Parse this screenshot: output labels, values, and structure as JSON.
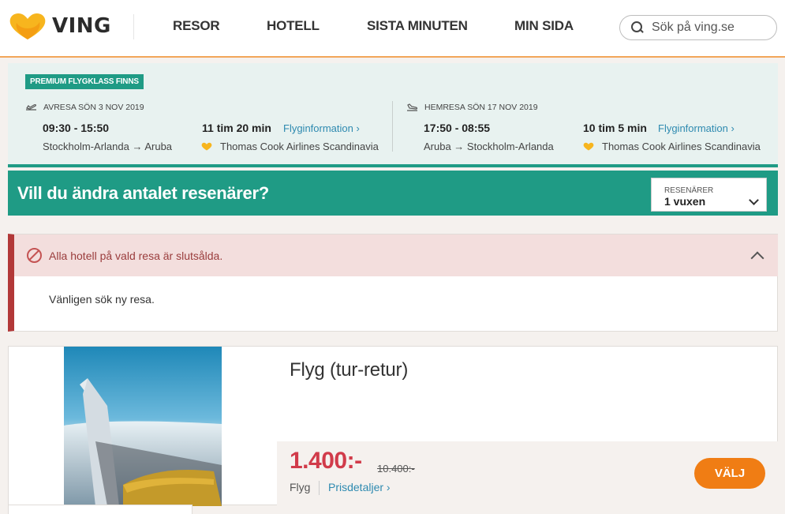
{
  "header": {
    "logo_text": "VING",
    "nav": [
      "RESOR",
      "HOTELL",
      "SISTA MINUTEN",
      "MIN SIDA"
    ],
    "search_placeholder": "Sök på ving.se"
  },
  "flight": {
    "badge": "PREMIUM FLYGKLASS FINNS",
    "outbound": {
      "heading": "AVRESA SÖN 3 NOV 2019",
      "times": "09:30 - 15:50",
      "route": "Stockholm-Arlanda → Aruba",
      "duration": "11 tim 20 min",
      "info_link": "Flyginformation",
      "airline": "Thomas Cook Airlines Scandinavia"
    },
    "inbound": {
      "heading": "HEMRESA SÖN 17 NOV 2019",
      "times": "17:50 - 08:55",
      "route": "Aruba → Stockholm-Arlanda",
      "duration": "10 tim 5 min",
      "info_link": "Flyginformation",
      "airline": "Thomas Cook Airlines Scandinavia"
    }
  },
  "travellers": {
    "title": "Vill du ändra antalet resenärer?",
    "select_label": "RESENÄRER",
    "select_value": "1 vuxen"
  },
  "alert": {
    "title": "Alla hotell på vald resa är slutsålda.",
    "body": "Vänligen sök ny resa."
  },
  "offer": {
    "title": "Flyg (tur-retur)",
    "price": "1.400:-",
    "old_price": "10.400:-",
    "type": "Flyg",
    "details_link": "Prisdetaljer",
    "button": "VÄLJ"
  },
  "colors": {
    "teal": "#1f9b85",
    "orange": "#f07d14",
    "price_red": "#d13b4a",
    "alert_red": "#b23838",
    "link_blue": "#2e8ab0"
  }
}
